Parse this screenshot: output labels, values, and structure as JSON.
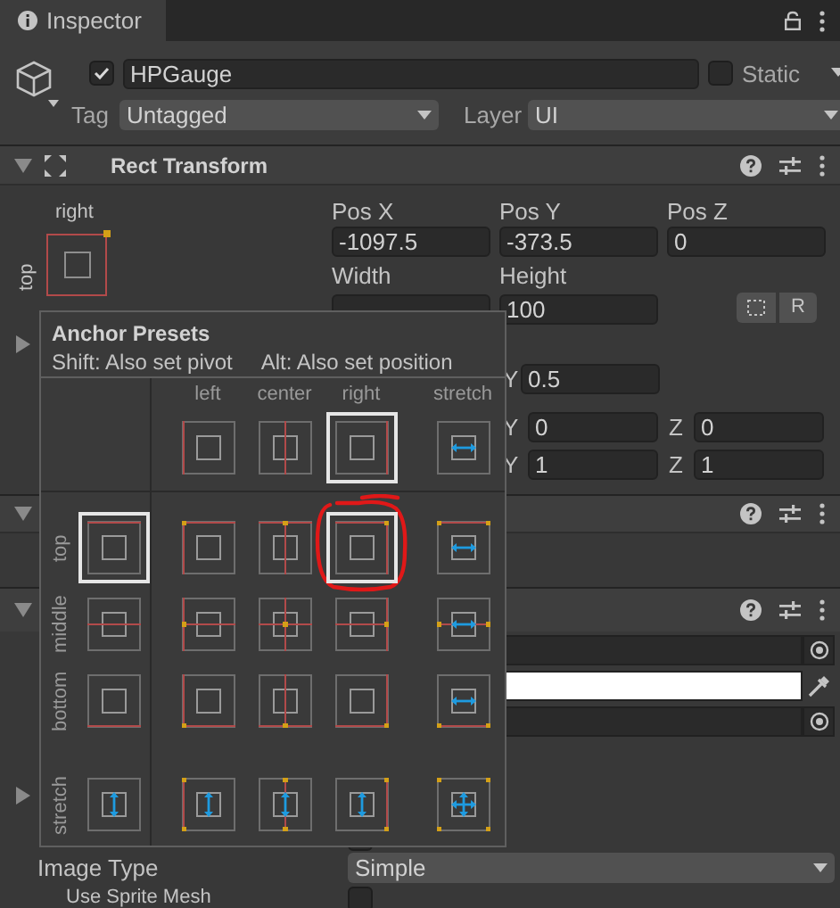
{
  "tab": {
    "title": "Inspector"
  },
  "object": {
    "active": true,
    "name": "HPGauge",
    "static": false,
    "static_label": "Static",
    "tag_label": "Tag",
    "tag": "Untagged",
    "layer_label": "Layer",
    "layer": "UI"
  },
  "rect_transform": {
    "expanded": true,
    "title": "Rect Transform",
    "anchor_h_label": "right",
    "anchor_v_label": "top",
    "fields": [
      {
        "label": "Pos X",
        "value": "-1097.5"
      },
      {
        "label": "Pos Y",
        "value": "-373.5"
      },
      {
        "label": "Pos Z",
        "value": "0"
      },
      {
        "label": "Width"
      },
      {
        "label": "Height",
        "value": "100"
      }
    ],
    "raw_edit_button": "R",
    "anchors_expanded": false,
    "pivot": {
      "label": "Y",
      "value": "0.5"
    },
    "rows": [
      {
        "fields": [
          {
            "label": "Y",
            "value": "0"
          },
          {
            "label": "Z",
            "value": "0"
          }
        ]
      },
      {
        "fields": [
          {
            "label": "Y",
            "value": "1"
          },
          {
            "label": "Z",
            "value": "1"
          }
        ]
      }
    ]
  },
  "components": [
    {
      "expanded": true
    },
    {
      "expanded": true
    }
  ],
  "image": {
    "fields": [
      {
        "kind": "object"
      },
      {
        "kind": "color",
        "color": "#ffffff"
      },
      {
        "kind": "object"
      }
    ],
    "foldout_expanded": false,
    "image_type_label": "Image Type",
    "image_type": "Simple",
    "use_sprite_mesh_label": "Use Sprite Mesh",
    "use_sprite_mesh": false
  },
  "anchor_presets": {
    "title": "Anchor Presets",
    "hints": [
      "Shift: Also set pivot",
      "Alt: Also set position"
    ],
    "columns": [
      {
        "label": "left",
        "selected": false
      },
      {
        "label": "center",
        "selected": false
      },
      {
        "label": "right",
        "selected": true
      },
      {
        "label": "stretch",
        "selected": false
      }
    ],
    "rows": [
      {
        "label": "top",
        "selected": true,
        "cells": [
          {
            "selected": false,
            "circled": false
          },
          {
            "selected": false,
            "circled": false
          },
          {
            "selected": true,
            "circled": true
          },
          {
            "selected": false,
            "circled": false
          }
        ]
      },
      {
        "label": "middle",
        "selected": false,
        "cells": [
          {
            "selected": false,
            "circled": false
          },
          {
            "selected": false,
            "circled": false
          },
          {
            "selected": false,
            "circled": false
          },
          {
            "selected": false,
            "circled": false
          }
        ]
      },
      {
        "label": "bottom",
        "selected": false,
        "cells": [
          {
            "selected": false,
            "circled": false
          },
          {
            "selected": false,
            "circled": false
          },
          {
            "selected": false,
            "circled": false
          },
          {
            "selected": false,
            "circled": false
          }
        ]
      },
      {
        "label": "stretch",
        "selected": false,
        "cells": [
          {
            "selected": false,
            "circled": false
          },
          {
            "selected": false,
            "circled": false
          },
          {
            "selected": false,
            "circled": false
          },
          {
            "selected": false,
            "circled": false
          }
        ]
      }
    ]
  }
}
